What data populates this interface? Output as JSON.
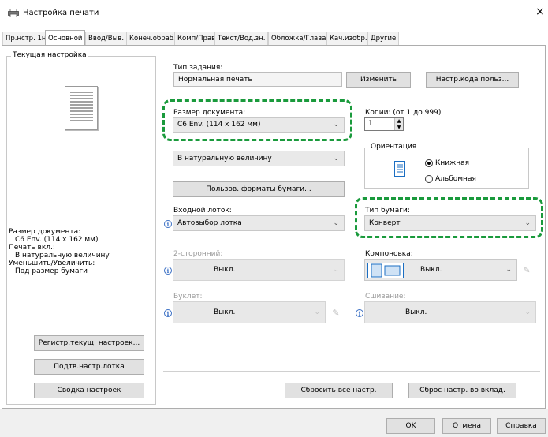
{
  "window": {
    "title": "Настройка печати",
    "close_glyph": "×"
  },
  "tabs": [
    {
      "label": "Пр.нстр. 1н"
    },
    {
      "label": "Основной"
    },
    {
      "label": "Ввод/Выв."
    },
    {
      "label": "Конеч.обраб."
    },
    {
      "label": "Комп/Прав"
    },
    {
      "label": "Текст/Вод.зн."
    },
    {
      "label": "Обложка/Глава"
    },
    {
      "label": "Кач.изобр."
    },
    {
      "label": "Другие"
    }
  ],
  "left_panel": {
    "group_title": "Текущая настройка",
    "summary_lines": [
      "Размер документа:",
      "C6 Env. (114 x 162 мм)",
      "Печать вкл.:",
      "В натуральную величину",
      "Уменьшить/Увеличить:",
      "Под размер бумаги"
    ],
    "buttons": {
      "register": "Регистр.текущ. настроек...",
      "tray": "Подтв.настр.лотка",
      "summary": "Сводка настроек"
    }
  },
  "job": {
    "label": "Тип задания:",
    "value": "Нормальная печать",
    "change_button": "Изменить",
    "user_code_button": "Настр.кода польз..."
  },
  "doc_size": {
    "label": "Размер документа:",
    "value": "C6 Env. (114 x 162 мм)"
  },
  "copies": {
    "label": "Копии: (от 1 до 999)",
    "value": "1"
  },
  "scale": {
    "value": "В натуральную величину"
  },
  "orientation": {
    "group_title": "Ориентация",
    "portrait": "Книжная",
    "landscape": "Альбомная"
  },
  "custom_paper_button": "Пользов. форматы бумаги...",
  "input_tray": {
    "label": "Входной лоток:",
    "value": "Автовыбор лотка"
  },
  "paper_type": {
    "label": "Тип бумаги:",
    "value": "Конверт"
  },
  "duplex": {
    "label": "2-сторонний:",
    "value": "Выкл."
  },
  "layout": {
    "label": "Компоновка:",
    "value": "Выкл."
  },
  "booklet": {
    "label": "Буклет:",
    "value": "Выкл."
  },
  "stapling": {
    "label": "Сшивание:",
    "value": "Выкл."
  },
  "reset_buttons": {
    "reset_all": "Сбросить все настр.",
    "reset_tab": "Сброс настр. во вклад."
  },
  "footer": {
    "ok": "OK",
    "cancel": "Отмена",
    "help": "Справка"
  },
  "colors": {
    "highlight": "#1a9a3c",
    "info_icon": "#3a6fc4"
  }
}
